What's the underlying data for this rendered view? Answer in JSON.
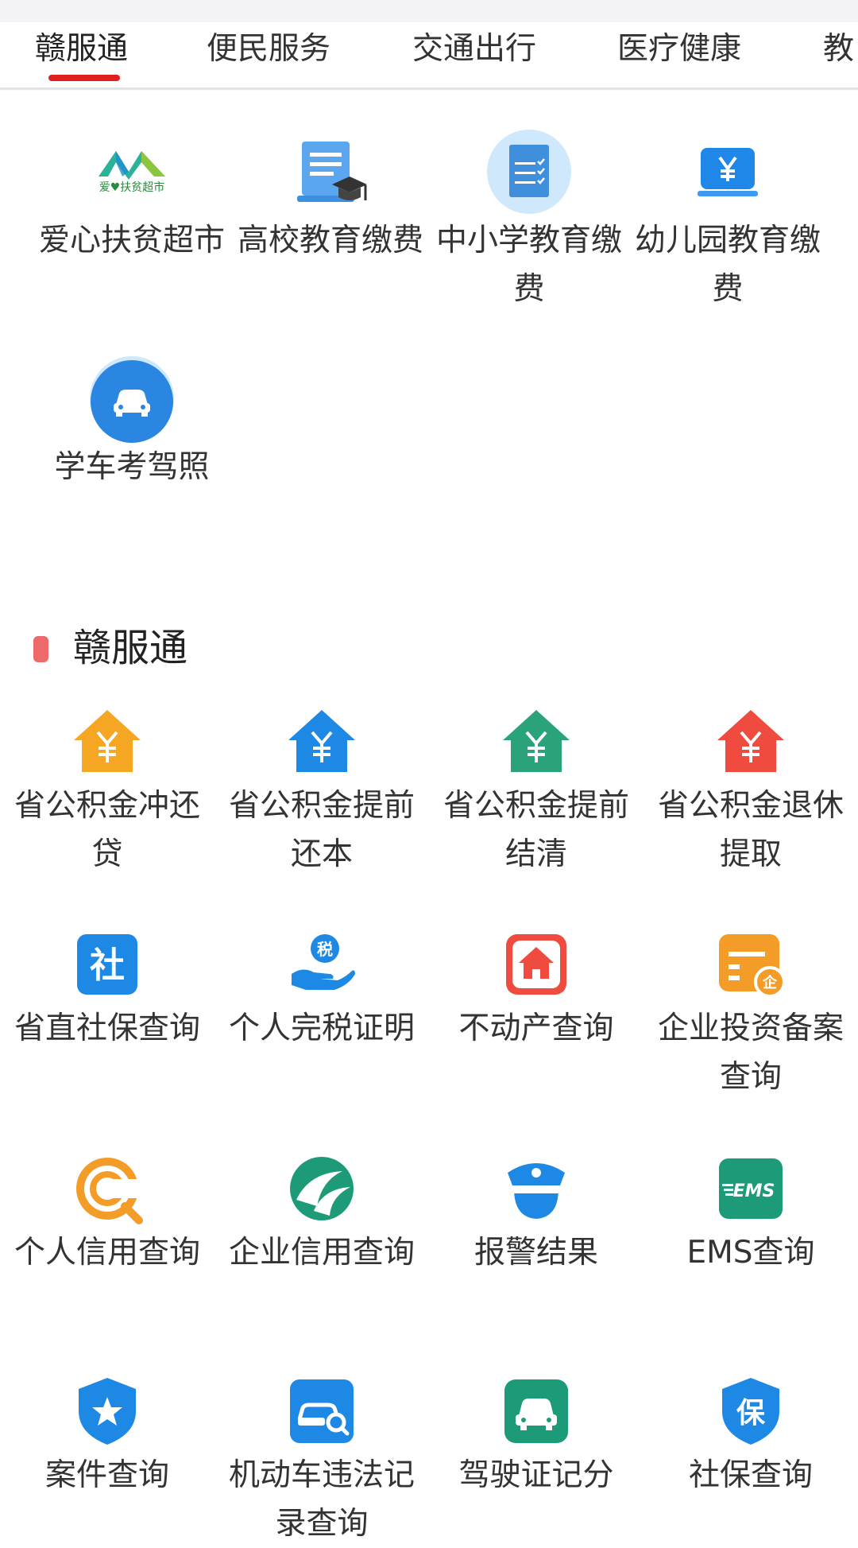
{
  "tabs": [
    {
      "label": "赣服通"
    },
    {
      "label": "便民服务"
    },
    {
      "label": "交通出行"
    },
    {
      "label": "医疗健康"
    },
    {
      "label": "教"
    }
  ],
  "education": {
    "items": [
      {
        "label": "爱心扶贫超市",
        "icon": "love-poverty-market-logo",
        "logo_text": "爱♥扶贫超市"
      },
      {
        "label": "高校教育缴费",
        "icon": "university-payment-icon"
      },
      {
        "label": "中小学教育缴费",
        "icon": "school-payment-icon"
      },
      {
        "label": "幼儿园教育缴费",
        "icon": "kindergarten-payment-icon"
      },
      {
        "label": "学车考驾照",
        "icon": "driving-school-icon"
      }
    ]
  },
  "section": {
    "title": "赣服通",
    "items": [
      {
        "label": "省公积金冲还贷",
        "icon": "housing-fund-icon",
        "color": "#f5a623"
      },
      {
        "label": "省公积金提前还本",
        "icon": "housing-fund-icon",
        "color": "#1e88e5"
      },
      {
        "label": "省公积金提前结清",
        "icon": "housing-fund-icon",
        "color": "#2aa37a"
      },
      {
        "label": "省公积金退休提取",
        "icon": "housing-fund-icon",
        "color": "#ef4b3f"
      },
      {
        "label": "省直社保查询",
        "icon": "social-security-icon",
        "glyph": "社"
      },
      {
        "label": "个人完税证明",
        "icon": "tax-hand-icon",
        "glyph": "税"
      },
      {
        "label": "不动产查询",
        "icon": "real-estate-icon"
      },
      {
        "label": "企业投资备案查询",
        "icon": "enterprise-filing-icon",
        "glyph": "企"
      },
      {
        "label": "个人信用查询",
        "icon": "personal-credit-icon"
      },
      {
        "label": "企业信用查询",
        "icon": "enterprise-credit-icon"
      },
      {
        "label": "报警结果",
        "icon": "police-icon"
      },
      {
        "label": "EMS查询",
        "icon": "ems-icon",
        "glyph": "EMS"
      },
      {
        "label": "案件查询",
        "icon": "case-shield-icon"
      },
      {
        "label": "机动车违法记录查询",
        "icon": "vehicle-violation-icon"
      },
      {
        "label": "驾驶证记分",
        "icon": "license-points-icon"
      },
      {
        "label": "社保查询",
        "icon": "social-insurance-shield-icon",
        "glyph": "保"
      }
    ]
  }
}
